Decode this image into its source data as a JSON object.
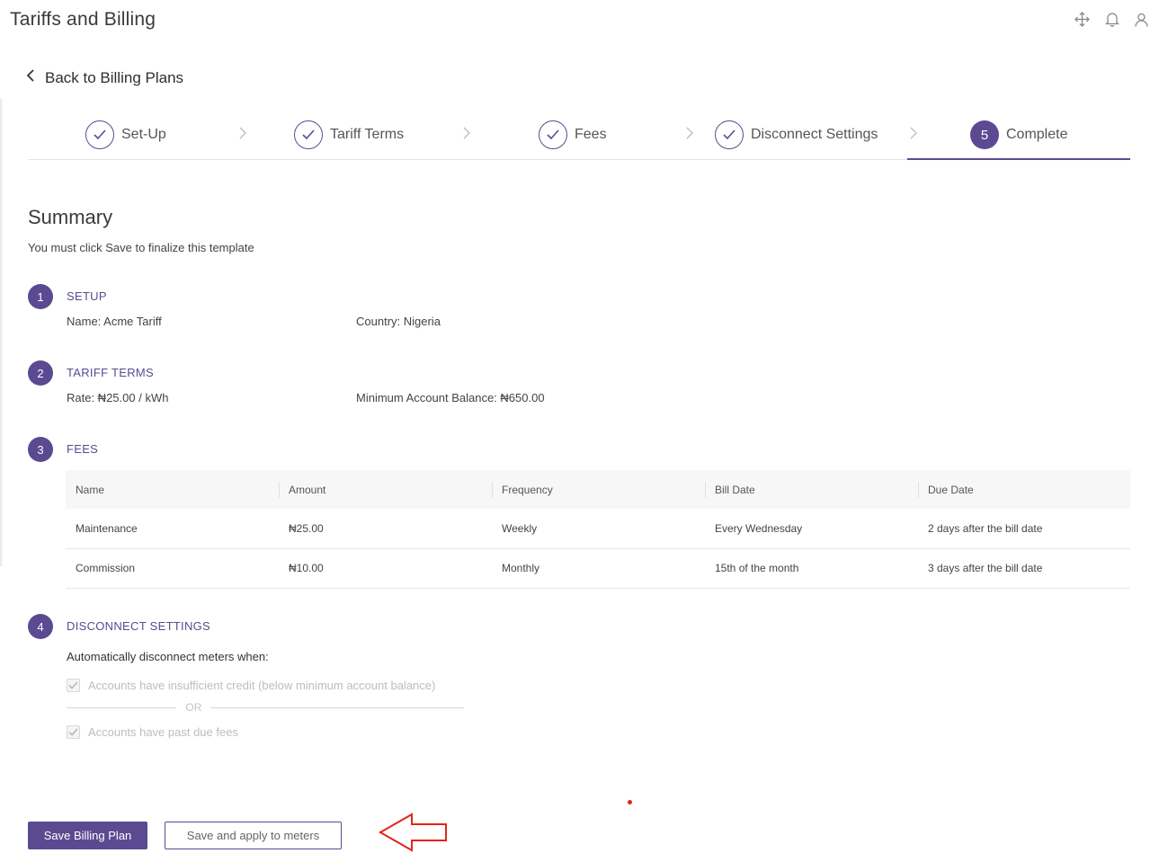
{
  "header": {
    "title": "Tariffs and Billing",
    "icons": [
      "move-icon",
      "bell-icon",
      "user-icon"
    ]
  },
  "back_link": "Back to Billing Plans",
  "steps": [
    {
      "label": "Set-Up",
      "state": "done"
    },
    {
      "label": "Tariff Terms",
      "state": "done"
    },
    {
      "label": "Fees",
      "state": "done"
    },
    {
      "label": "Disconnect Settings",
      "state": "done"
    },
    {
      "label": "Complete",
      "state": "active",
      "number": "5"
    }
  ],
  "summary": {
    "title": "Summary",
    "subtitle": "You must click Save to finalize this template",
    "sections": [
      {
        "number": "1",
        "title": "SETUP",
        "fields": [
          "Name: Acme Tariff",
          "Country: Nigeria"
        ]
      },
      {
        "number": "2",
        "title": "TARIFF TERMS",
        "fields": [
          "Rate: ₦25.00 / kWh",
          "Minimum Account Balance: ₦650.00"
        ]
      },
      {
        "number": "3",
        "title": "FEES"
      },
      {
        "number": "4",
        "title": "DISCONNECT SETTINGS"
      }
    ]
  },
  "fees_table": {
    "columns": [
      "Name",
      "Amount",
      "Frequency",
      "Bill Date",
      "Due Date"
    ],
    "rows": [
      [
        "Maintenance",
        "₦25.00",
        "Weekly",
        "Every Wednesday",
        "2 days after the bill date"
      ],
      [
        "Commission",
        "₦10.00",
        "Monthly",
        "15th of the month",
        "3 days after the bill date"
      ]
    ]
  },
  "disconnect": {
    "label": "Automatically disconnect meters when:",
    "option1": "Accounts have insufficient credit (below minimum account balance)",
    "or": "OR",
    "option2": "Accounts have past due fees",
    "option1_checked": true,
    "option2_checked": true
  },
  "buttons": {
    "save": "Save Billing Plan",
    "save_apply": "Save and apply to meters"
  },
  "colors": {
    "accent": "#5b4a91",
    "annotation": "#e3241b"
  }
}
